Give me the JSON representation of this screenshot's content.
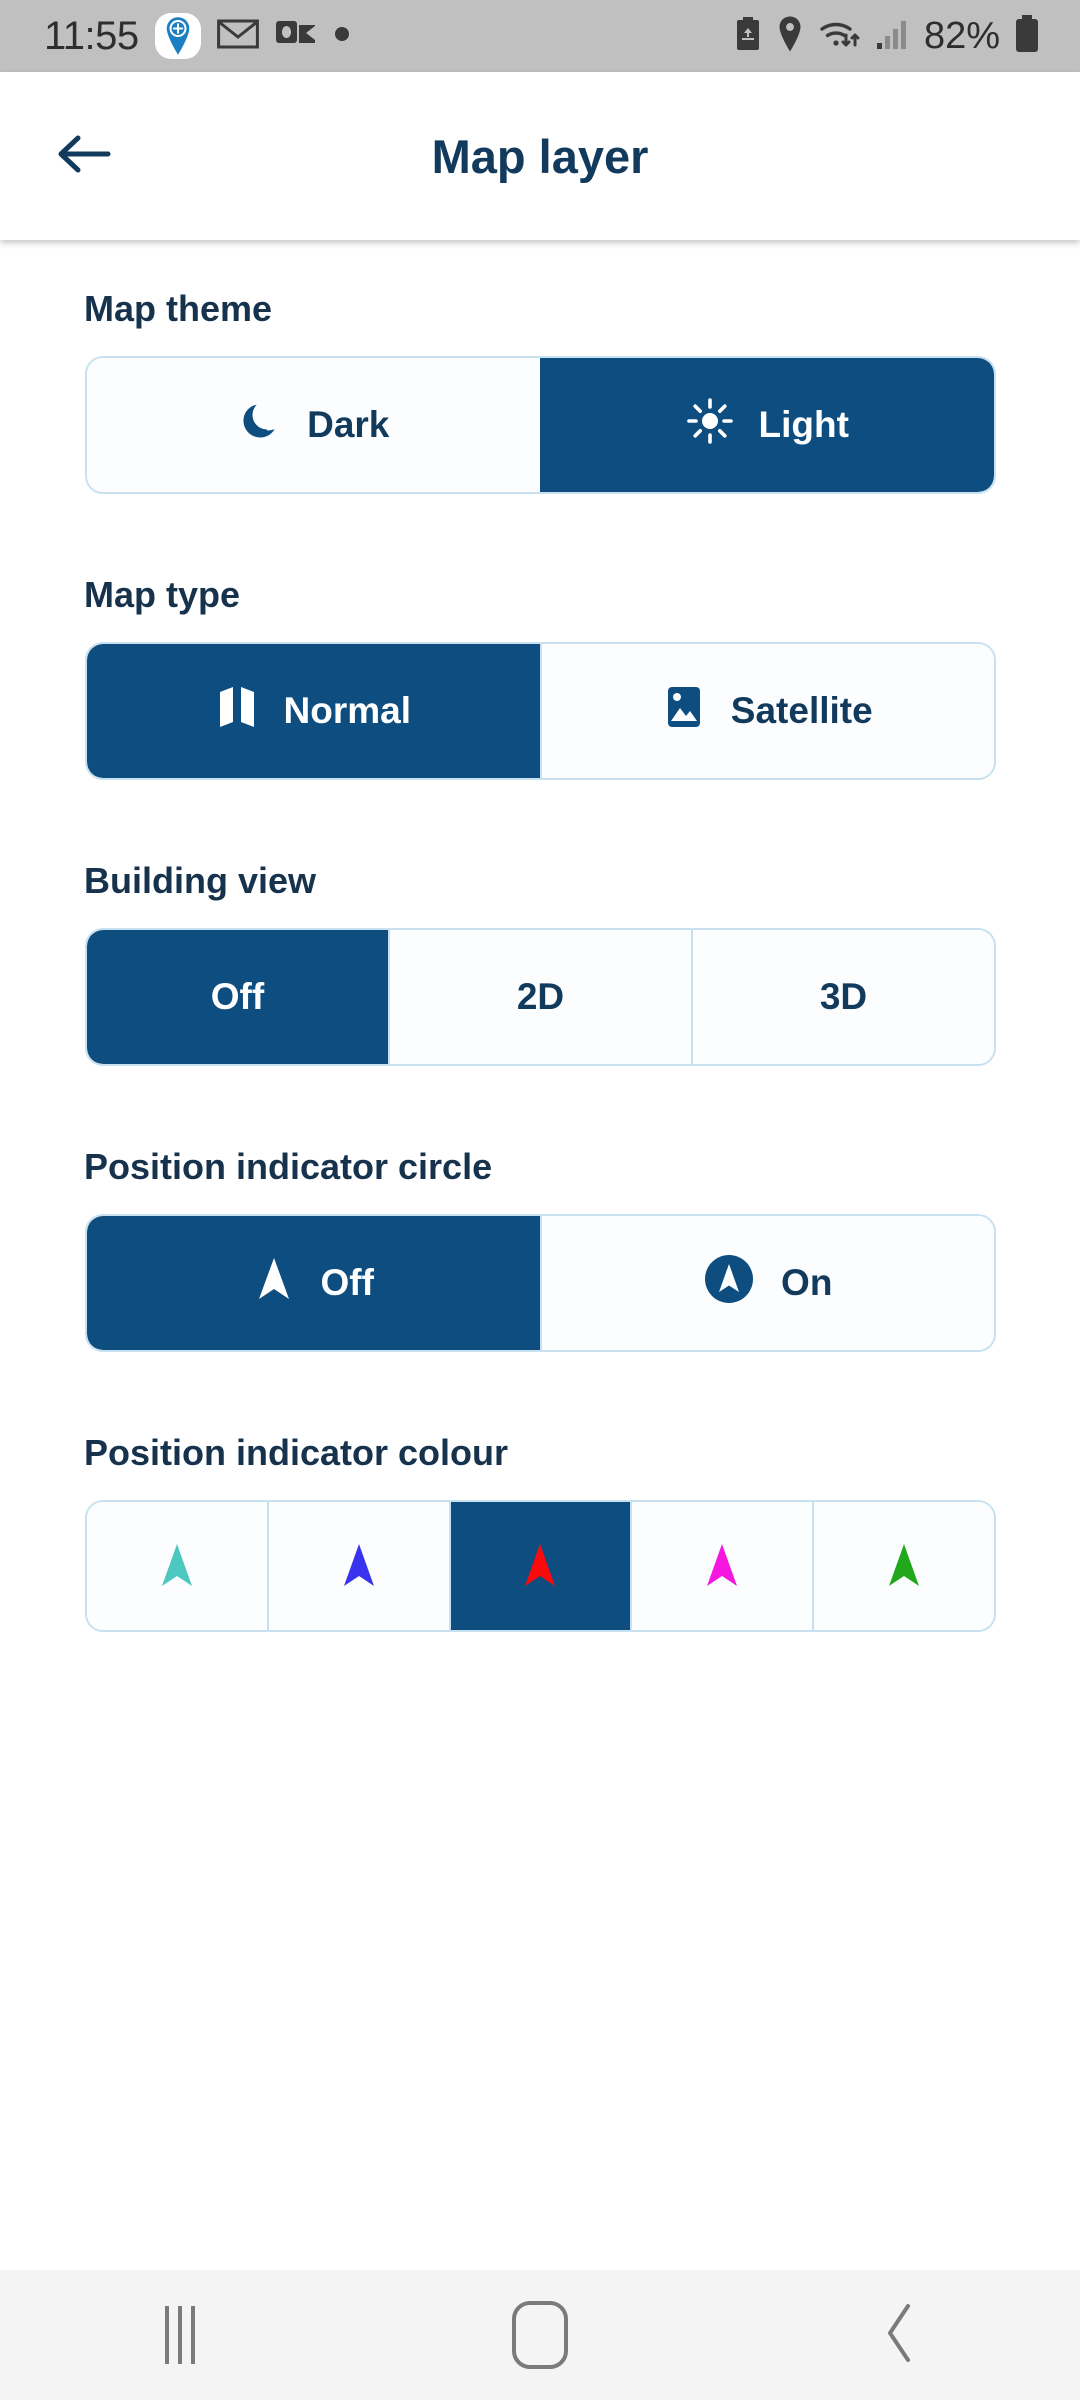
{
  "status_bar": {
    "time": "11:55",
    "battery_percent": "82%",
    "left_icons": [
      "location-pin-add-icon",
      "mail-icon",
      "outlook-icon",
      "dot-icon"
    ],
    "right_icons": [
      "battery-saver-icon",
      "location-icon",
      "wifi-icon",
      "signal-icon",
      "battery-icon"
    ]
  },
  "app_bar": {
    "back_icon": "back-arrow-icon",
    "title": "Map layer"
  },
  "sections": {
    "map_theme": {
      "title": "Map theme",
      "options": [
        {
          "label": "Dark",
          "icon": "moon-icon",
          "selected": false
        },
        {
          "label": "Light",
          "icon": "sun-icon",
          "selected": true
        }
      ]
    },
    "map_type": {
      "title": "Map type",
      "options": [
        {
          "label": "Normal",
          "icon": "map-icon",
          "selected": true
        },
        {
          "label": "Satellite",
          "icon": "image-icon",
          "selected": false
        }
      ]
    },
    "building_view": {
      "title": "Building view",
      "options": [
        {
          "label": "Off",
          "selected": true
        },
        {
          "label": "2D",
          "selected": false
        },
        {
          "label": "3D",
          "selected": false
        }
      ]
    },
    "position_indicator_circle": {
      "title": "Position indicator circle",
      "options": [
        {
          "label": "Off",
          "icon": "navigation-arrow-icon",
          "selected": true
        },
        {
          "label": "On",
          "icon": "navigation-arrow-circle-icon",
          "selected": false
        }
      ]
    },
    "position_indicator_colour": {
      "title": "Position indicator colour",
      "options": [
        {
          "name": "turquoise",
          "colour": "#4DC8C0",
          "selected": false
        },
        {
          "name": "blue",
          "colour": "#3A33EE",
          "selected": false
        },
        {
          "name": "red",
          "colour": "#FA0A0A",
          "selected": true
        },
        {
          "name": "magenta",
          "colour": "#F517E0",
          "selected": false
        },
        {
          "name": "green",
          "colour": "#22A81C",
          "selected": false
        }
      ]
    }
  },
  "nav_bar": {
    "recents_label": "recents-icon",
    "home_label": "home-icon",
    "back_label": "back-chevron-icon"
  },
  "colours": {
    "accent": "#0E4D80",
    "title_text": "#16324C",
    "border": "#C8E1F0",
    "surface": "#FBFDFE",
    "status_bar_bg": "#C0C0C0",
    "nav_bar_bg": "#F4F4F4"
  }
}
